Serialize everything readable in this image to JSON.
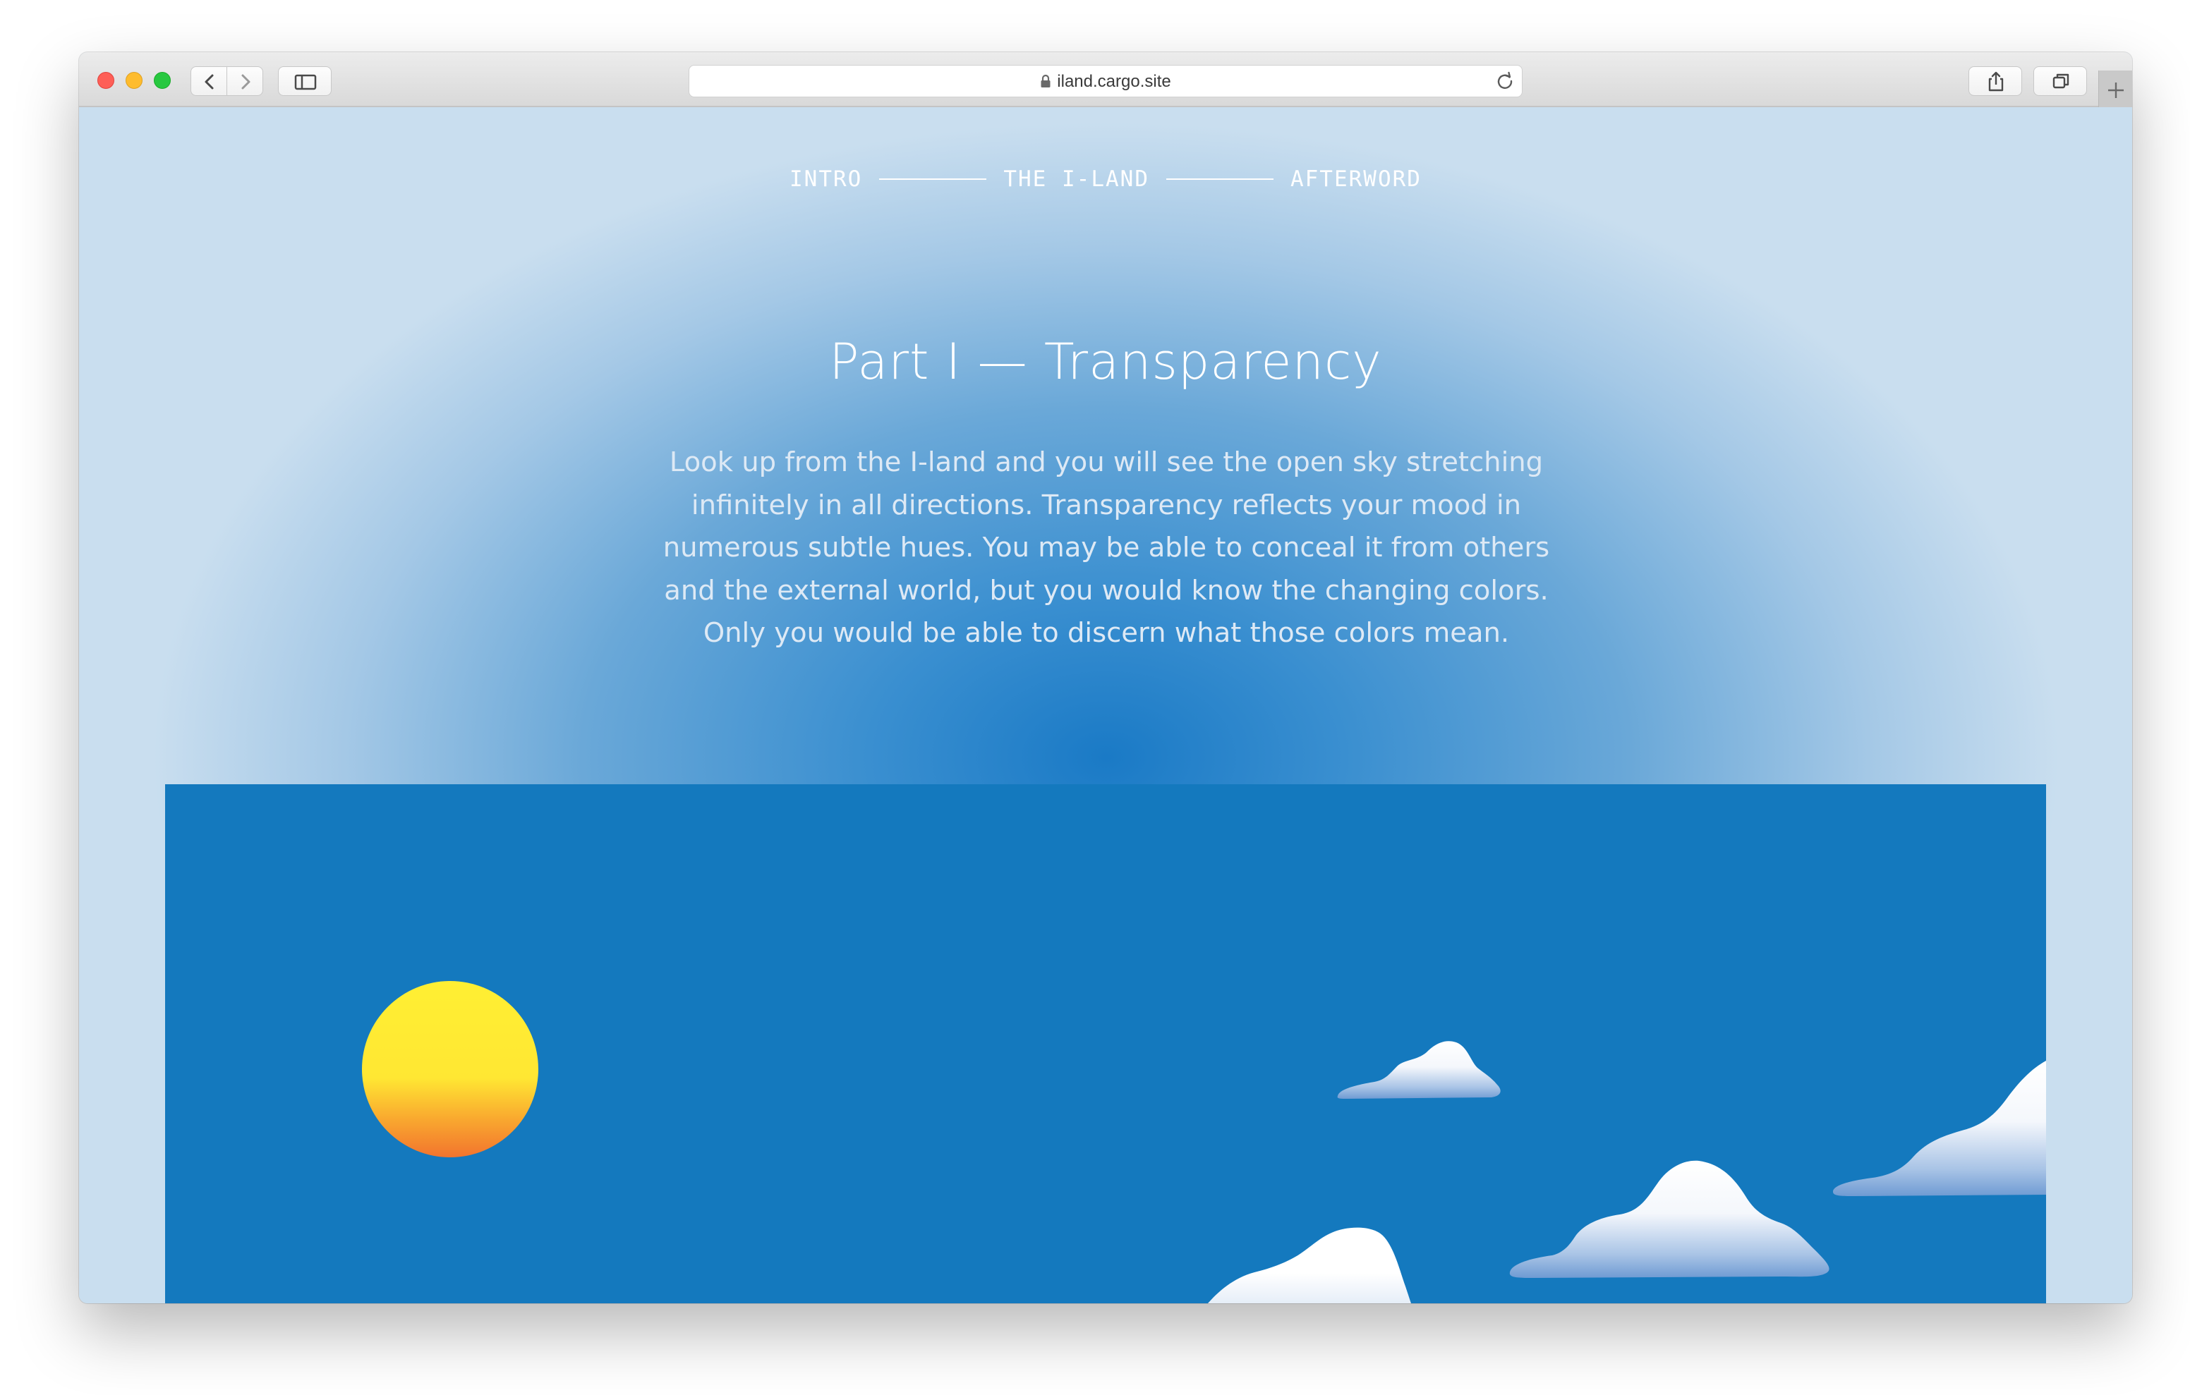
{
  "browser": {
    "url": "iland.cargo.site"
  },
  "nav": {
    "items": [
      "INTRO",
      "THE I-LAND",
      "AFTERWORD"
    ]
  },
  "section": {
    "title": "Part I — Transparency",
    "body": "Look up from the I-land and you will see the open sky stretching infinitely in all directions. Transparency reflects your mood in numerous subtle hues. You may be able to conceal it from others and the external world, but you would know the changing colors. Only you would be able to discern what those colors mean."
  },
  "colors": {
    "sky": "#1479be",
    "sun_top": "#ffeb33",
    "sun_bottom": "#f37c2f",
    "cloud": "#ffffff"
  },
  "icons": [
    "back-icon",
    "forward-icon",
    "sidebar-icon",
    "lock-icon",
    "reload-icon",
    "share-icon",
    "tabs-icon",
    "plus-icon"
  ]
}
